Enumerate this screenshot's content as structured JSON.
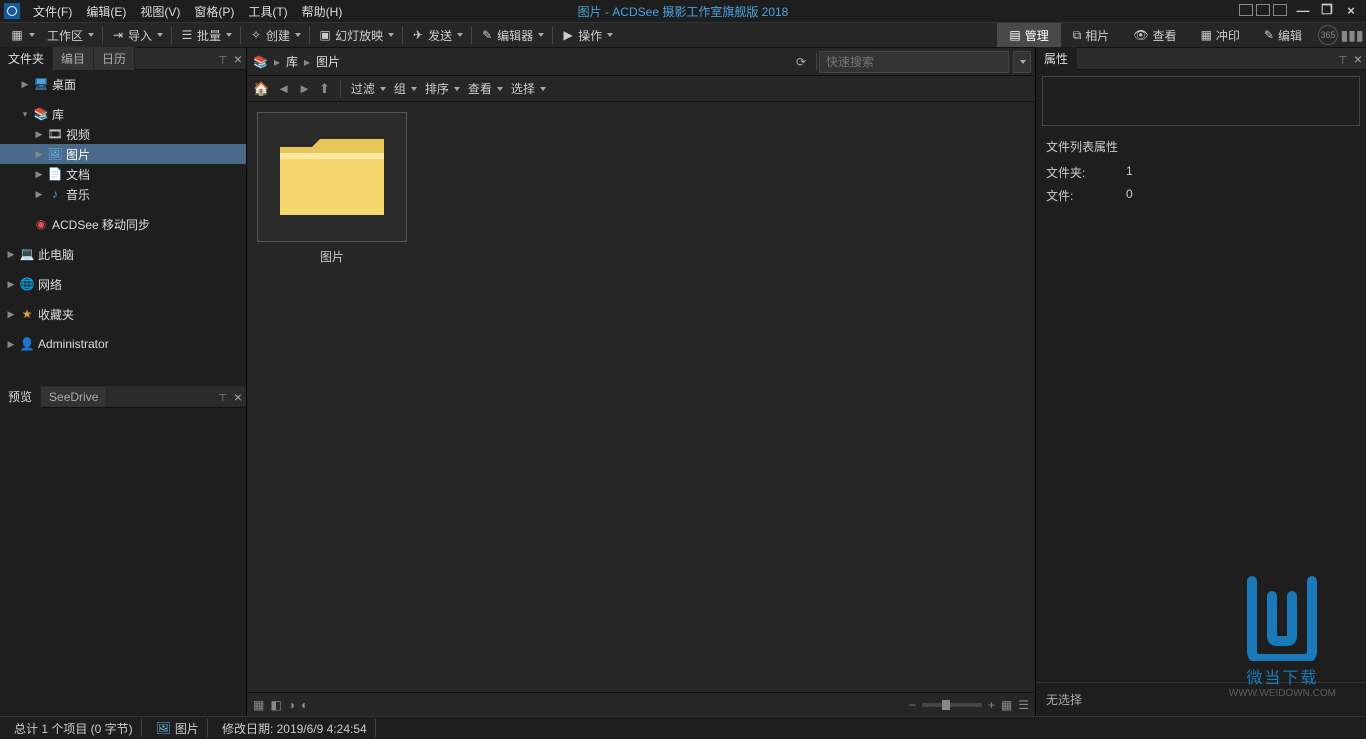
{
  "title": "图片 - ACDSee 摄影工作室旗舰版 2018",
  "menu": [
    "文件(F)",
    "编辑(E)",
    "视图(V)",
    "窗格(P)",
    "工具(T)",
    "帮助(H)"
  ],
  "toolbar": {
    "workspace": "工作区",
    "import": "导入",
    "batch": "批量",
    "create": "创建",
    "slideshow": "幻灯放映",
    "send": "发送",
    "editor": "编辑器",
    "action": "操作"
  },
  "modes": {
    "manage": "管理",
    "photo": "相片",
    "view": "查看",
    "develop": "冲印",
    "edit": "编辑"
  },
  "left_tabs": {
    "folders": "文件夹",
    "catalog": "编目",
    "calendar": "日历"
  },
  "tree": {
    "desktop": "桌面",
    "libraries": "库",
    "videos": "视频",
    "pictures": "图片",
    "documents": "文档",
    "music": "音乐",
    "sync": "ACDSee 移动同步",
    "thispc": "此电脑",
    "network": "网络",
    "favorites": "收藏夹",
    "admin": "Administrator"
  },
  "bottom_tabs": {
    "preview": "预览",
    "seedrive": "SeeDrive"
  },
  "address": {
    "root": "库",
    "current": "图片"
  },
  "search_placeholder": "快速搜索",
  "navbar": {
    "filter": "过滤",
    "group": "组",
    "sort": "排序",
    "view": "查看",
    "select": "选择"
  },
  "thumb_caption": "图片",
  "right": {
    "tab": "属性",
    "section": "文件列表属性",
    "folders_k": "文件夹:",
    "folders_v": "1",
    "files_k": "文件:",
    "files_v": "0",
    "nosel": "无选择"
  },
  "status": {
    "items": "总计 1 个项目  (0 字节)",
    "loc": "图片",
    "mod": "修改日期: 2019/6/9 4:24:54"
  },
  "watermark": {
    "t1": "微当下载",
    "t2": "WWW.WEIDOWN.COM"
  }
}
